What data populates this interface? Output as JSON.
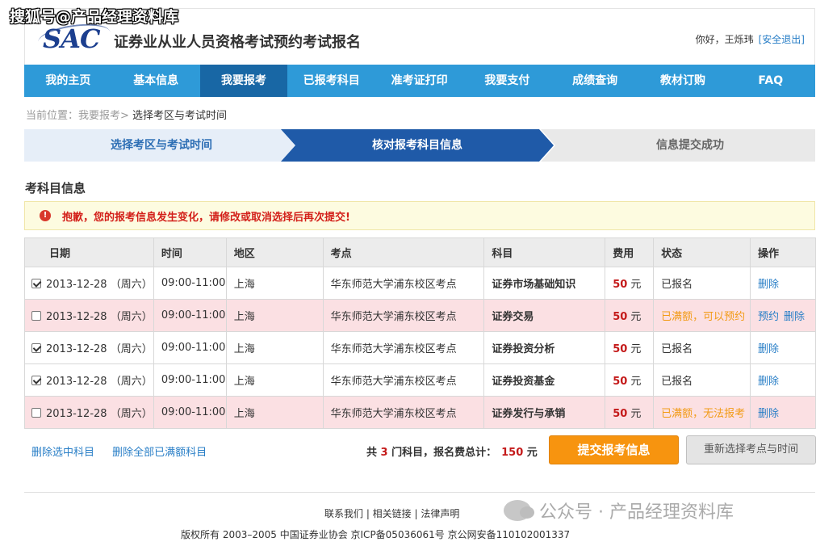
{
  "watermark_top": "搜狐号@产品经理资料库",
  "header": {
    "logo": "SAC",
    "title": "证券业从业人员资格考试预约考试报名",
    "greeting": "你好，王烁玮",
    "logout": "[安全退出]"
  },
  "nav": [
    {
      "label": "我的主页"
    },
    {
      "label": "基本信息"
    },
    {
      "label": "我要报考",
      "active": true
    },
    {
      "label": "已报考科目"
    },
    {
      "label": "准考证打印"
    },
    {
      "label": "我要支付"
    },
    {
      "label": "成绩查询"
    },
    {
      "label": "教材订购"
    },
    {
      "label": "FAQ"
    }
  ],
  "breadcrumb": {
    "prefix": "当前位置：",
    "parent": "我要报考>",
    "current": " 选择考区与考试时间"
  },
  "steps": [
    "选择考区与考试时间",
    "核对报考科目信息",
    "信息提交成功"
  ],
  "section_title": "考科目信息",
  "alert": {
    "icon": "!",
    "text": "抱歉，您的报考信息发生变化，请修改或取消选择后再次提交!"
  },
  "table": {
    "headers": [
      "日期",
      "时间",
      "地区",
      "考点",
      "科目",
      "费用",
      "状态",
      "操作"
    ],
    "rows": [
      {
        "checked": true,
        "date": "2013-12-28",
        "weekday": "（周六）",
        "time": "09:00-11:00",
        "region": "上海",
        "site": "华东师范大学浦东校区考点",
        "subject": "证券市场基础知识",
        "fee": "50",
        "unit": "元",
        "status": "已报名",
        "full": false,
        "ops": [
          "删除"
        ]
      },
      {
        "checked": false,
        "date": "2013-12-28",
        "weekday": "（周六）",
        "time": "09:00-11:00",
        "region": "上海",
        "site": "华东师范大学浦东校区考点",
        "subject": "证券交易",
        "fee": "50",
        "unit": "元",
        "status": "已满额，可以预约",
        "full": true,
        "ops": [
          "预约",
          "删除"
        ]
      },
      {
        "checked": true,
        "date": "2013-12-28",
        "weekday": "（周六）",
        "time": "09:00-11:00",
        "region": "上海",
        "site": "华东师范大学浦东校区考点",
        "subject": "证券投资分析",
        "fee": "50",
        "unit": "元",
        "status": "已报名",
        "full": false,
        "ops": [
          "删除"
        ]
      },
      {
        "checked": true,
        "date": "2013-12-28",
        "weekday": "（周六）",
        "time": "09:00-11:00",
        "region": "上海",
        "site": "华东师范大学浦东校区考点",
        "subject": "证券投资基金",
        "fee": "50",
        "unit": "元",
        "status": "已报名",
        "full": false,
        "ops": [
          "删除"
        ]
      },
      {
        "checked": false,
        "date": "2013-12-28",
        "weekday": "（周六）",
        "time": "09:00-11:00",
        "region": "上海",
        "site": "华东师范大学浦东校区考点",
        "subject": "证券发行与承销",
        "fee": "50",
        "unit": "元",
        "status": "已满额，无法报考",
        "full": true,
        "ops": [
          "删除"
        ]
      }
    ]
  },
  "actions": {
    "delete_selected": "删除选中科目",
    "delete_full": "删除全部已满额科目",
    "summary_a": "共 ",
    "count": "3",
    "summary_b": " 门科目，报名费总计：",
    "total": "150",
    "summary_c": " 元",
    "submit": "提交报考信息",
    "reset": "重新选择考点与时间"
  },
  "footer": {
    "links": "联系我们 | 相关链接 | 法律声明",
    "copyright": "版权所有 2003–2005 中国证券业协会    京ICP备05036061号 京公网安备110102001337"
  },
  "watermark_bottom": "公众号 · 产品经理资料库",
  "colors": {
    "nav": "#2e9ad8",
    "nav_active": "#1867a5",
    "step_active": "#1f5aa8",
    "submit": "#f7940f",
    "alert_text": "#d3201a"
  }
}
